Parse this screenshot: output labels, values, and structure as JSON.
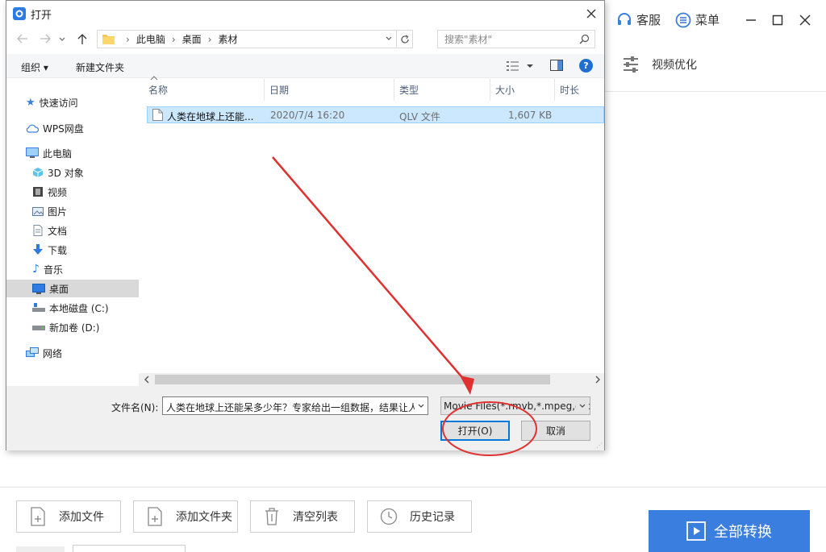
{
  "app": {
    "service_label": "客服",
    "menu_label": "菜单",
    "optimize_label": "视频优化",
    "bottom_buttons": [
      "添加文件",
      "添加文件夹",
      "清空列表",
      "历史记录"
    ],
    "convert_all_label": "全部转换",
    "accent_color": "#3a7fe0",
    "annotation_color": "#e03131"
  },
  "dialog": {
    "title": "打开",
    "breadcrumb": [
      "此电脑",
      "桌面",
      "素材"
    ],
    "search_placeholder": "搜索\"素材\"",
    "toolbar": {
      "organize": "组织 ▾",
      "new_folder": "新建文件夹"
    },
    "nav": {
      "quick_access": "快速访问",
      "wps": "WPS网盘",
      "this_pc": "此电脑",
      "items": [
        "3D 对象",
        "视频",
        "图片",
        "文档",
        "下载",
        "音乐",
        "桌面",
        "本地磁盘 (C:)",
        "新加卷 (D:)"
      ],
      "network": "网络"
    },
    "columns": {
      "name": "名称",
      "date": "日期",
      "type": "类型",
      "size": "大小",
      "duration": "时长"
    },
    "files": [
      {
        "name": "人类在地球上还能...",
        "date": "2020/7/4 16:20",
        "type": "QLV 文件",
        "size": "1,607 KB"
      }
    ],
    "filename_label": "文件名(N):",
    "filename_value": "人类在地球上还能呆多少年？专家给出一组数据，结果让人",
    "filter_value": "Movie Files(*.rmvb,*.mpeg,etc)",
    "open_label": "打开(O)",
    "cancel_label": "取消"
  }
}
